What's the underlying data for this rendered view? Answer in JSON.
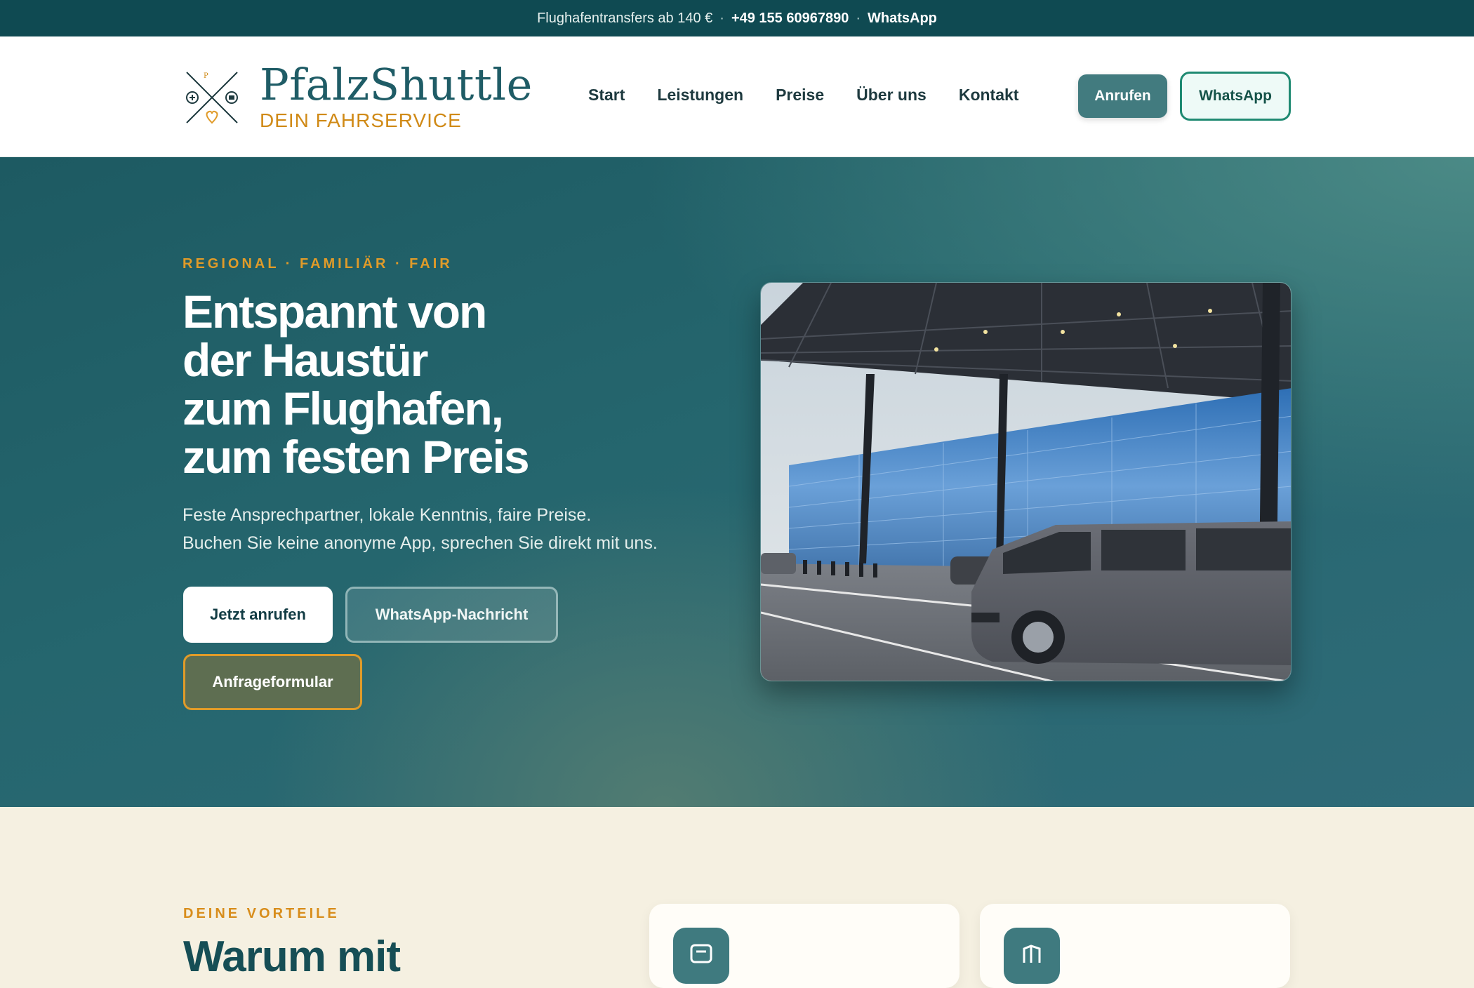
{
  "topbar": {
    "text": "Flughafentransfers ab 140 €",
    "phone": "+49 155 60967890",
    "whatsapp": "WhatsApp"
  },
  "header": {
    "logo_title": "PfalzShuttle",
    "logo_sub": "DEIN FAHRSERVICE",
    "nav": [
      "Start",
      "Leistungen",
      "Preise",
      "Über uns",
      "Kontakt"
    ],
    "call_button": "Anrufen",
    "whatsapp_button": "WhatsApp"
  },
  "hero": {
    "eyebrow": "REGIONAL · FAMILIÄR · FAIR",
    "title_lines": [
      "Entspannt von",
      "der Haustür",
      "zum Flughafen,",
      "zum festen Preis"
    ],
    "lead_lines": [
      "Feste Ansprechpartner, lokale Kenntnis, faire Preise.",
      "Buchen Sie keine anonyme App, sprechen Sie direkt mit uns."
    ],
    "btn_call": "Jetzt anrufen",
    "btn_whatsapp": "WhatsApp-Nachricht",
    "btn_form": "Anfrageformular"
  },
  "benefits": {
    "eyebrow": "DEINE VORTEILE",
    "title": "Warum mit"
  },
  "colors": {
    "brand_teal": "#0f4a52",
    "accent_orange": "#e09b29",
    "whatsapp_green": "#1f8a72"
  }
}
